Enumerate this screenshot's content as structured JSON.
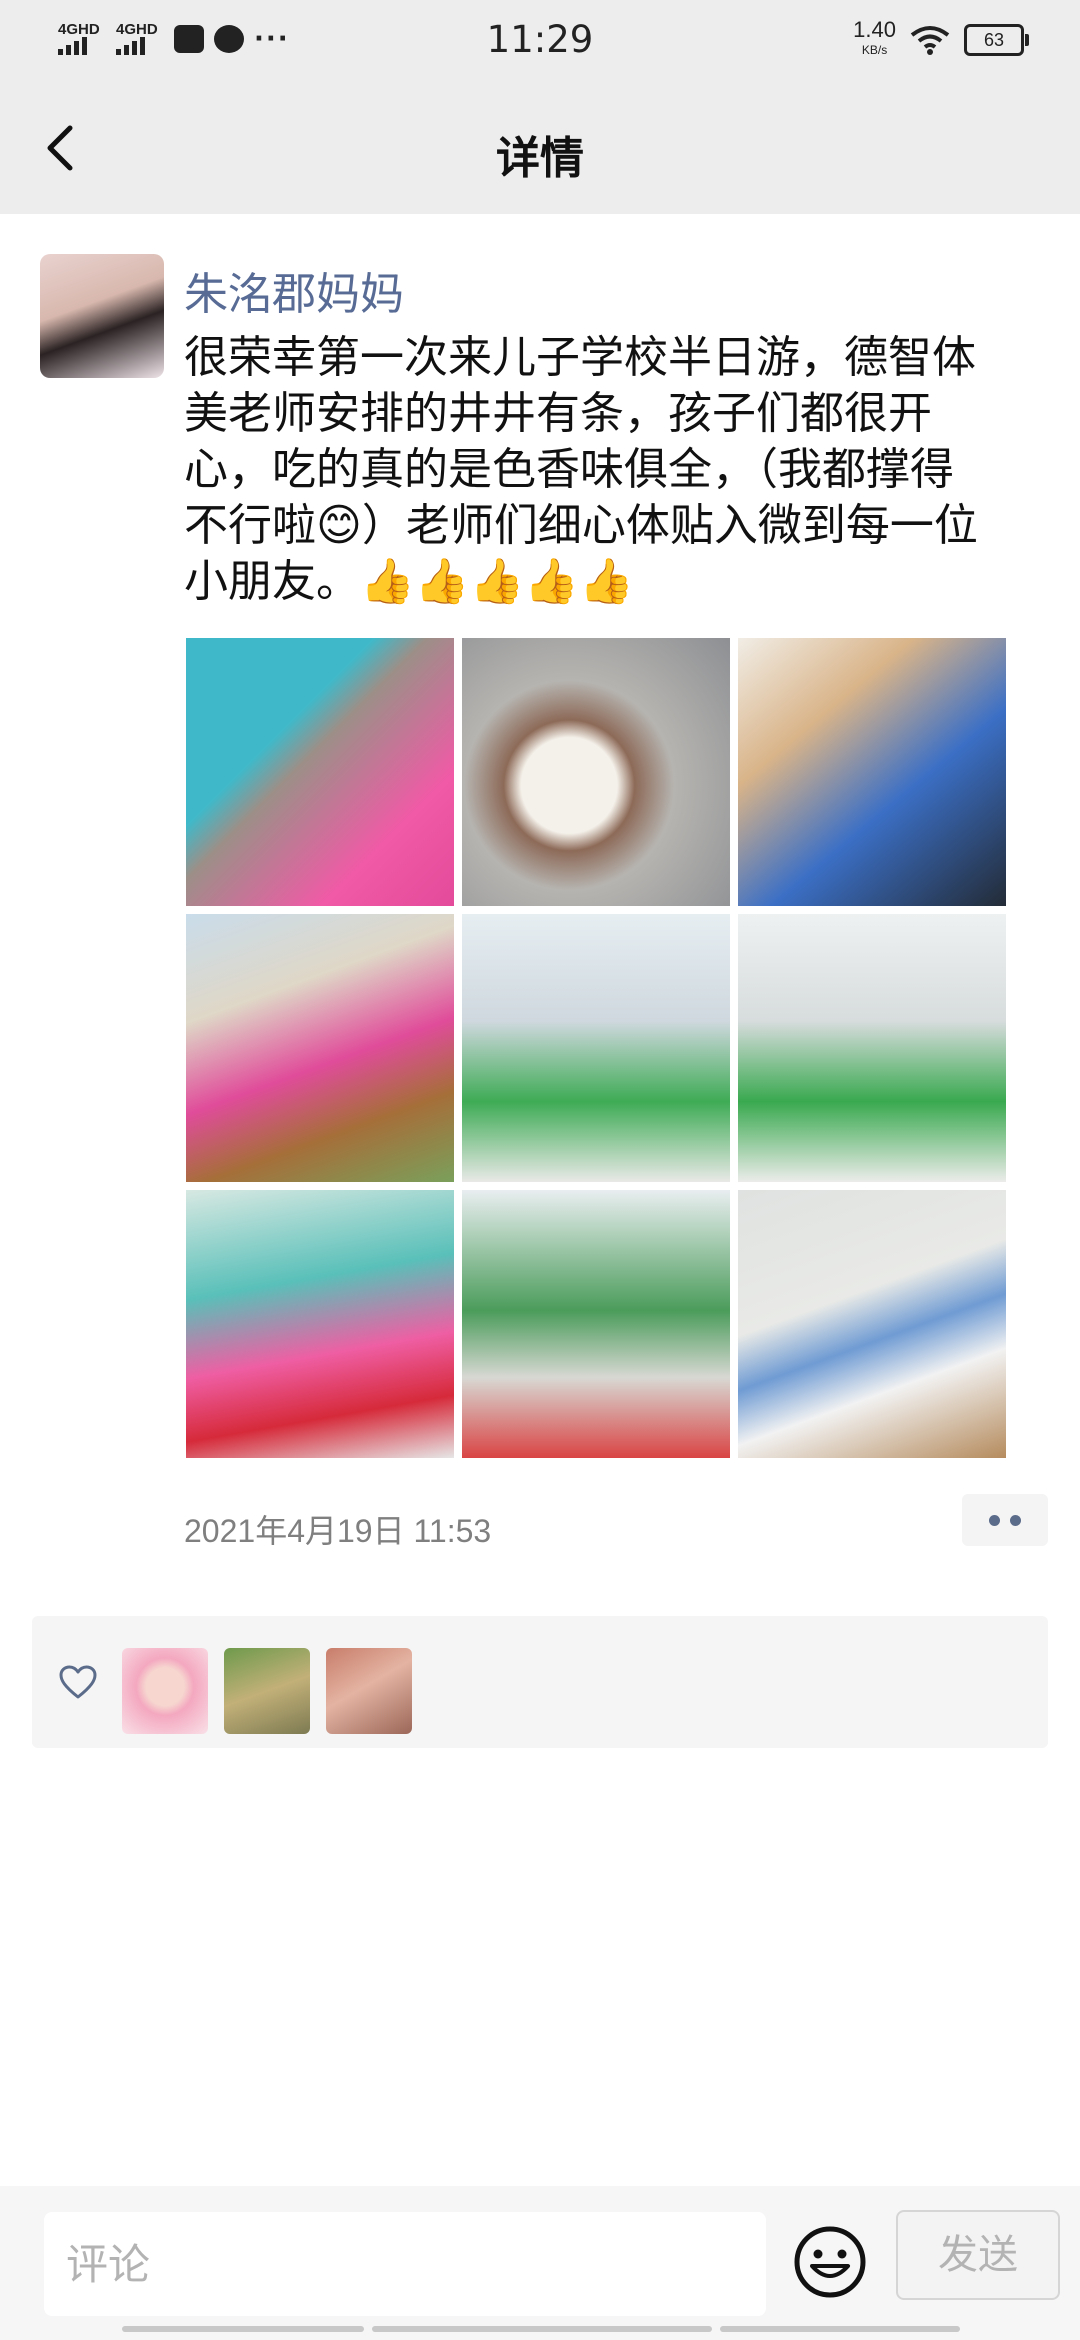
{
  "status_bar": {
    "network_1": "4GHD",
    "network_2": "4GHD",
    "more_indicator": "···",
    "time": "11:29",
    "speed_value": "1.40",
    "speed_unit": "KB/s",
    "battery": "63"
  },
  "nav": {
    "title": "详情",
    "back_icon": "chevron-left-icon"
  },
  "post": {
    "author": "朱洺郡妈妈",
    "text": "很荣幸第一次来儿子学校半日游，德智体\n美老师安排的井井有条，孩子们都很开\n心，吃的真的是色香味俱全，（我都撑得\n不行啦😊）老师们细心体贴入微到每一位\n小朋友。👍👍👍👍👍",
    "timestamp": "2021年4月19日 11:53",
    "photos": [
      "child-eating-photo",
      "lunch-plate-photo",
      "children-at-table-photo",
      "child-climbing-photo",
      "classroom-photo",
      "classroom-raising-hands-photo",
      "children-in-class-photo",
      "children-playing-photo",
      "child-building-blocks-photo"
    ]
  },
  "likes": {
    "icon": "heart-icon",
    "likers": [
      "liker-avatar-1",
      "liker-avatar-2",
      "liker-avatar-3"
    ]
  },
  "comment_bar": {
    "placeholder": "评论",
    "emoji_icon": "smiley-icon",
    "send_label": "发送"
  },
  "colors": {
    "author_link": "#576b95",
    "header_bg": "#ededed",
    "timestamp": "#7f7f7f",
    "likes_bg": "#f5f5f5"
  }
}
